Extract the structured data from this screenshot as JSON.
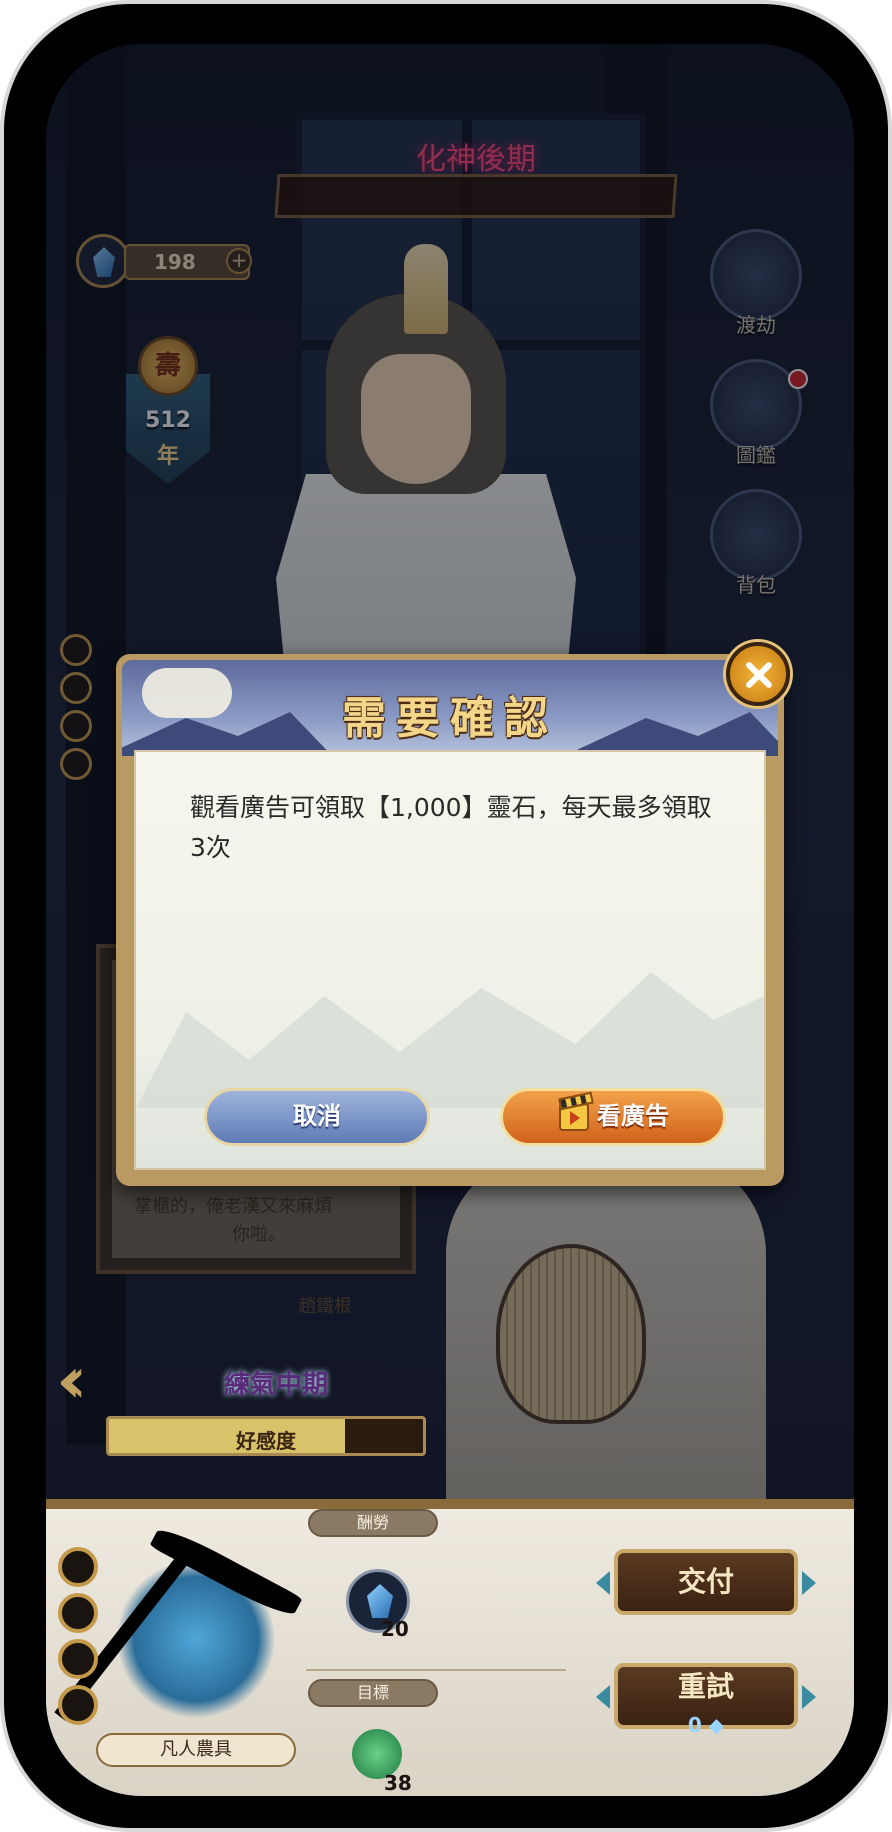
{
  "game": {
    "realm_banner": "化神後期",
    "spirit_stones": "198",
    "lifespan": {
      "icon_char": "壽",
      "value": "512",
      "unit": "年"
    },
    "side_menu": [
      {
        "label": "渡劫",
        "icon": "tribulation-icon",
        "badge": false
      },
      {
        "label": "圖鑑",
        "icon": "book-icon",
        "badge": true
      },
      {
        "label": "背包",
        "icon": "bag-icon",
        "badge": false
      }
    ]
  },
  "npc": {
    "dialogue_line1": "掌櫃的，俺老漢又來麻煩",
    "dialogue_line2": "你啦。",
    "name": "趙鐵根",
    "cultivation_rank": "練氣中期",
    "favor_label": "好感度",
    "favor_fraction": 0.75
  },
  "task": {
    "tool_name": "凡人農具",
    "reward_tag": "酬勞",
    "reward_count": "20",
    "target_tag": "目標",
    "target_count": "38",
    "deliver_label": "交付",
    "retry_label": "重試",
    "retry_cost": "0"
  },
  "dialog": {
    "title": "需要確認",
    "message": "觀看廣告可領取【1,000】靈石，每天最多領取3次",
    "cancel_label": "取消",
    "watch_label": "看廣告"
  },
  "colors": {
    "accent_gold": "#c9a86a",
    "dialog_title": "#f3d68a",
    "cancel_blue": "#5f7bb6",
    "watch_orange": "#d0621a"
  }
}
